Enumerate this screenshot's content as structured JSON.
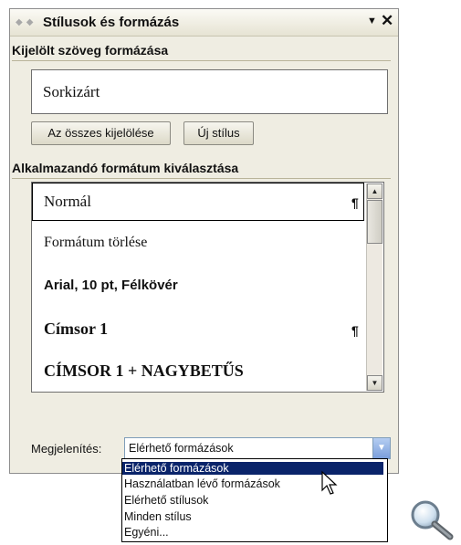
{
  "pane": {
    "title": "Stílusok és formázás",
    "menu_icon": "▼",
    "close_icon": "✕"
  },
  "selected_section": {
    "heading": "Kijelölt szöveg formázása",
    "current_format": "Sorkizárt"
  },
  "buttons": {
    "select_all": "Az összes kijelölése",
    "new_style": "Új stílus"
  },
  "apply_section": {
    "heading": "Alkalmazandó formátum kiválasztása",
    "items": [
      {
        "label": "Normál",
        "mark": "¶"
      },
      {
        "label": "Formátum törlése",
        "mark": ""
      },
      {
        "label": "Arial, 10 pt, Félkövér",
        "mark": ""
      },
      {
        "label": "Címsor 1",
        "mark": "¶"
      },
      {
        "label": "CÍMSOR 1 + NAGYBETŰS",
        "mark": ""
      }
    ]
  },
  "display": {
    "label": "Megjelenítés:",
    "value": "Elérhető formázások",
    "options": [
      "Elérhető formázások",
      "Használatban lévő formázások",
      "Elérhető stílusok",
      "Minden stílus",
      "Egyéni..."
    ],
    "selected_index": 0
  },
  "icons": {
    "scroll_up": "up-arrow-icon",
    "scroll_down": "down-arrow-icon",
    "dropdown": "chevron-down-icon",
    "cursor": "mouse-pointer-icon",
    "zoom": "magnifier-icon"
  },
  "colors": {
    "pane_bg": "#efede2",
    "selection": "#0a246a",
    "combo_button": "#7a9fdc"
  }
}
